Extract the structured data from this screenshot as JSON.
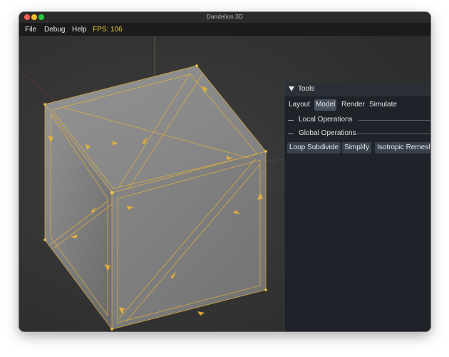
{
  "window": {
    "title": "Dandelion 3D"
  },
  "menubar": {
    "items": [
      "File",
      "Debug",
      "Help"
    ],
    "fps_label": "FPS: 106"
  },
  "tools_panel": {
    "title": "Tools",
    "tabs": [
      {
        "label": "Layout",
        "active": false
      },
      {
        "label": "Model",
        "active": true
      },
      {
        "label": "Render",
        "active": false
      },
      {
        "label": "Simulate",
        "active": false
      }
    ],
    "sections": [
      "Local Operations",
      "Global Operations"
    ],
    "buttons": [
      "Loop Subdivide",
      "Simplify",
      "Isotropic Remesh"
    ]
  },
  "colors": {
    "viewport_bg": "#3a3a3a",
    "cube_face": "#8c8c8c",
    "edge_highlight": "#e8b33a",
    "fps_text": "#e8d23a",
    "panel_bg": "#1f2228",
    "tab_active": "#48515f"
  },
  "icons": {
    "window_buttons": [
      "close-dot-icon",
      "minimize-dot-icon",
      "maximize-dot-icon"
    ],
    "panel_collapse": "triangle-down-icon"
  }
}
